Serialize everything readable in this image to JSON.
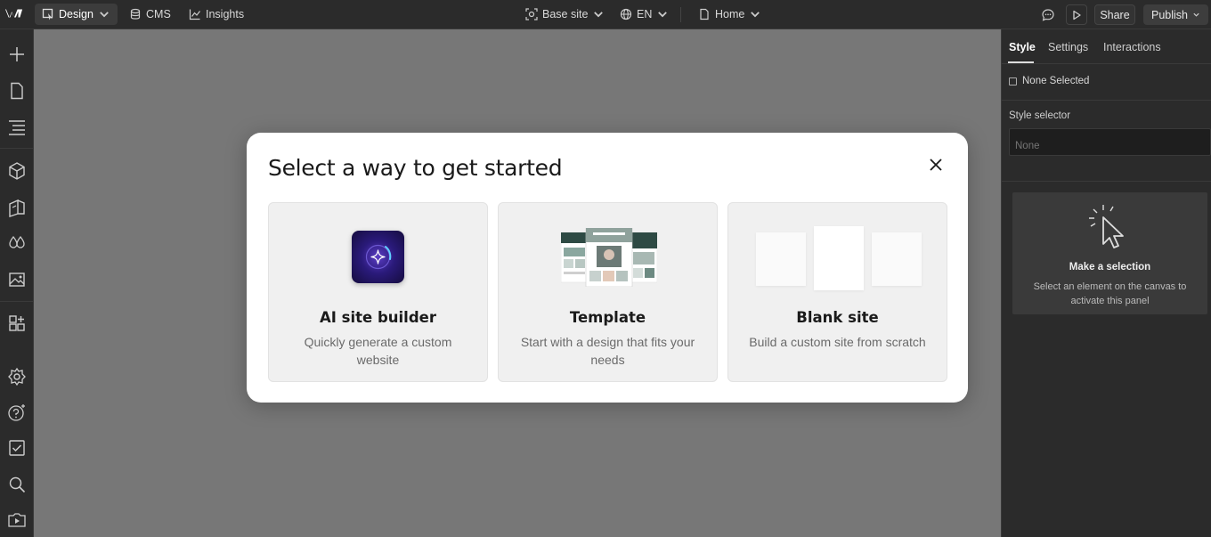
{
  "topbar": {
    "nav": [
      {
        "label": "Design",
        "active": true
      },
      {
        "label": "CMS",
        "active": false
      },
      {
        "label": "Insights",
        "active": false
      }
    ],
    "base_site": "Base site",
    "locale": "EN",
    "page": "Home",
    "share_label": "Share",
    "publish_label": "Publish"
  },
  "leftrail": {
    "icons": [
      "add-icon",
      "pages-icon",
      "navigator-icon",
      "components-icon",
      "cms-icon",
      "variables-icon",
      "assets-icon",
      "apps-icon",
      "settings-icon",
      "help-icon",
      "audit-icon",
      "search-icon",
      "video-icon"
    ]
  },
  "rightpanel": {
    "tabs": [
      "Style",
      "Settings",
      "Interactions"
    ],
    "active_tab": "Style",
    "none_selected": "None Selected",
    "style_selector_label": "Style selector",
    "style_selector_placeholder": "None",
    "selection_title": "Make a selection",
    "selection_desc": "Select an element on the canvas to activate this panel"
  },
  "modal": {
    "title": "Select a way to get started",
    "options": [
      {
        "title": "AI site builder",
        "desc": "Quickly generate a custom website",
        "icon": "ai-sparkle-icon"
      },
      {
        "title": "Template",
        "desc": "Start with a design that fits your needs",
        "icon": "template-preview"
      },
      {
        "title": "Blank site",
        "desc": "Build a custom site from scratch",
        "icon": "blank-pages"
      }
    ]
  },
  "colors": {
    "canvas": "#777777",
    "chrome": "#2b2b2b",
    "modal_bg": "#ffffff",
    "card_bg": "#f0f0f0",
    "ai_accent": "#5b3cc4"
  }
}
